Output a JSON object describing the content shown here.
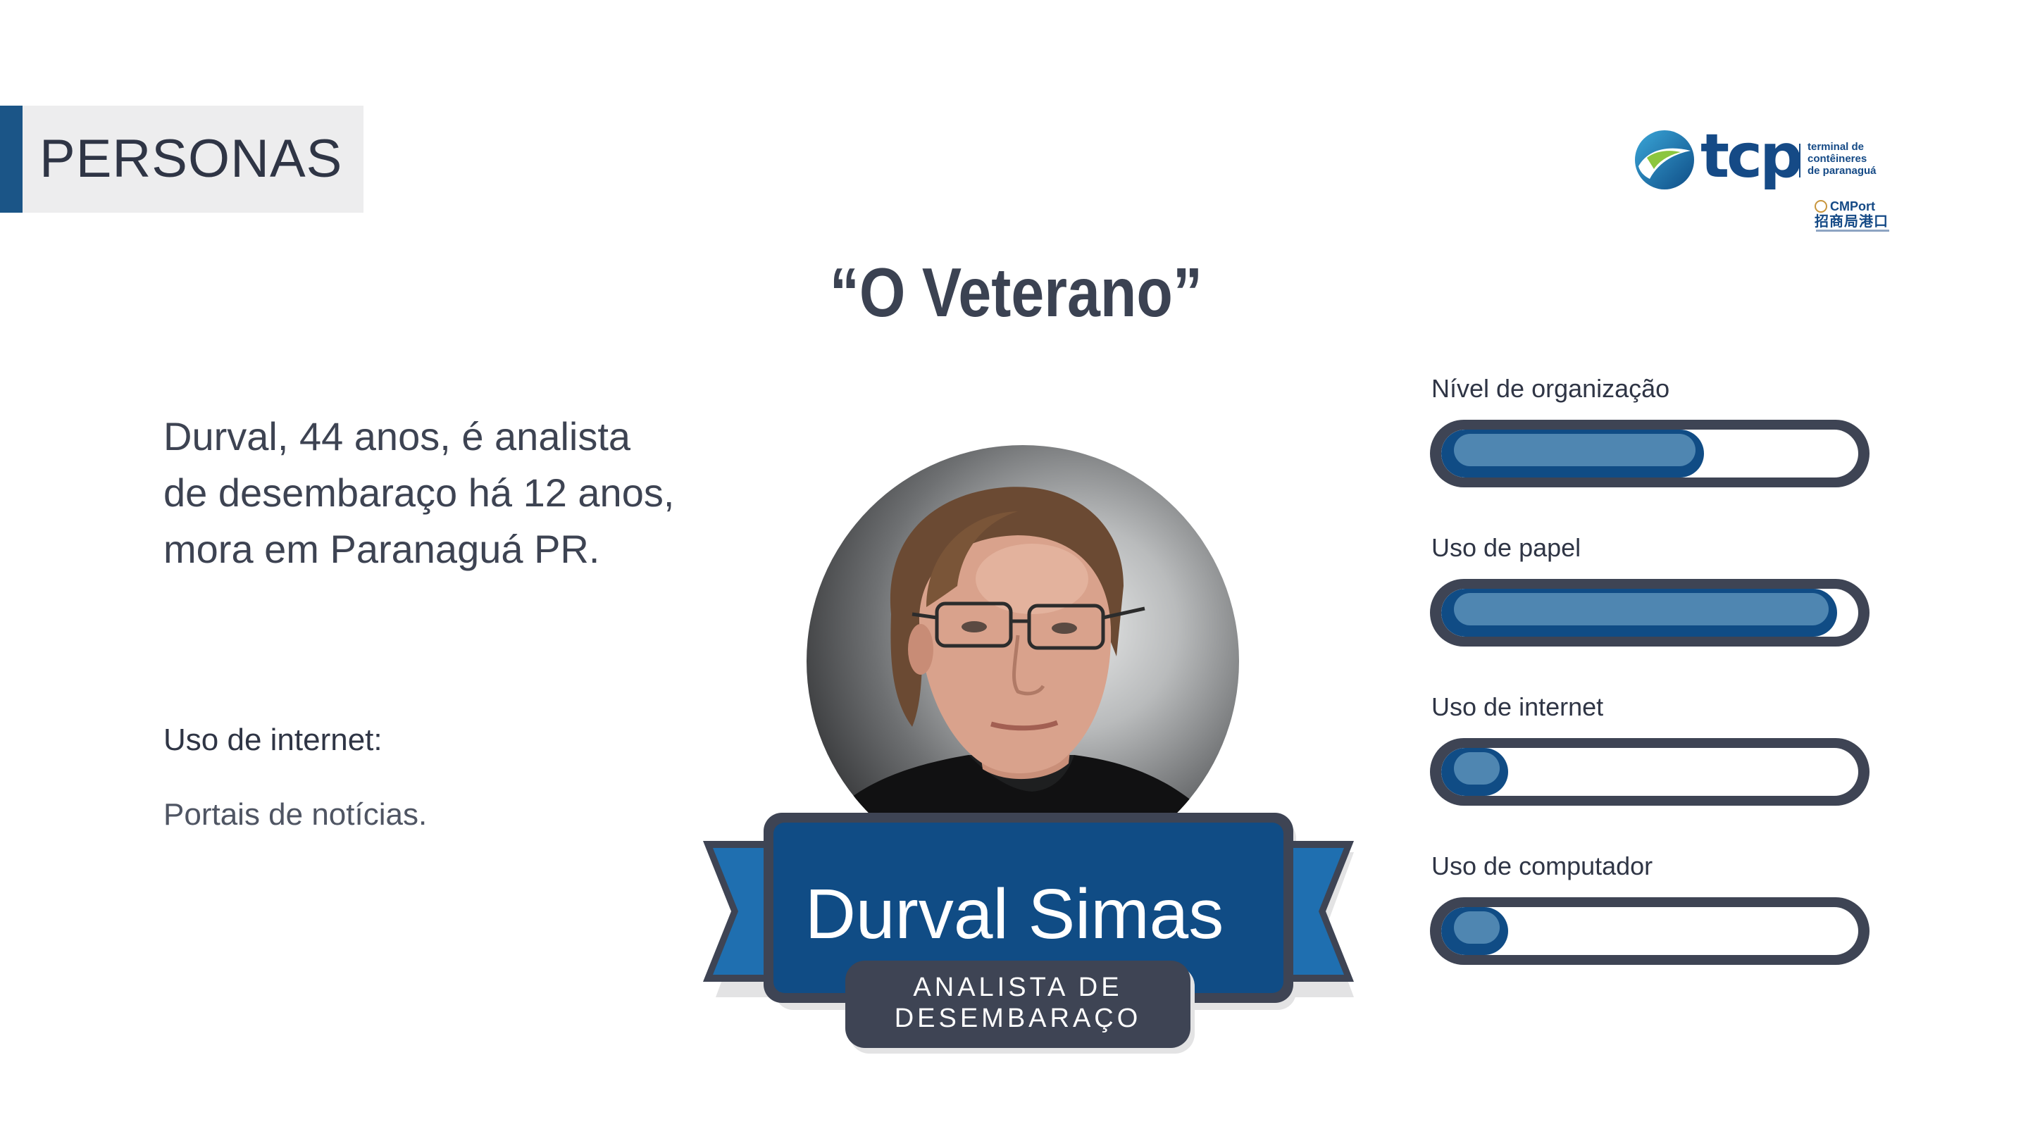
{
  "header": {
    "tag": "PERSONAS"
  },
  "logo": {
    "wordmark": "tcp",
    "sub": [
      "terminal de",
      "contêineres",
      "de paranaguá"
    ],
    "cmport_name": "CMPort",
    "cmport_cn": "招商局港口"
  },
  "persona": {
    "quote": "“O Veterano”",
    "bio": "Durval, 44 anos, é analista de desembaraço há 12 anos, mora em Paranaguá PR.",
    "internet_title": "Uso de internet:",
    "internet_value": "Portais de notícias.",
    "name": "Durval Simas",
    "role_line1": "ANALISTA DE",
    "role_line2": "DESEMBARAÇO"
  },
  "metrics": [
    {
      "label": "Nível de organização",
      "level": 0.63
    },
    {
      "label": "Uso de papel",
      "level": 0.95
    },
    {
      "label": "Uso de internet",
      "level": 0.16
    },
    {
      "label": "Uso de computador",
      "level": 0.16
    }
  ],
  "colors": {
    "accent_blue": "#104c85",
    "bar_highlight": "#4f86b1",
    "dark_slate": "#3e4454",
    "ribbon_light": "#1f6fb0"
  }
}
